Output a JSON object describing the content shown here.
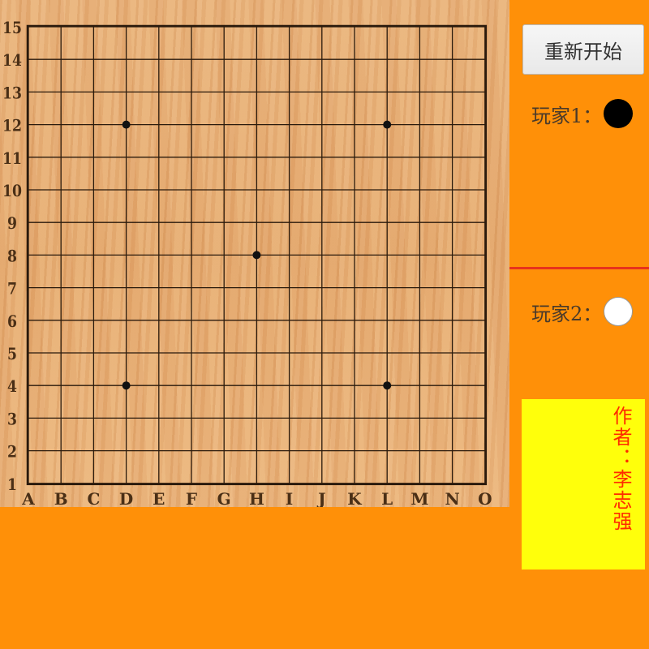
{
  "board": {
    "size": 15,
    "columns": [
      "A",
      "B",
      "C",
      "D",
      "E",
      "F",
      "G",
      "H",
      "I",
      "J",
      "K",
      "L",
      "M",
      "N",
      "O"
    ],
    "rows": [
      "15",
      "14",
      "13",
      "12",
      "11",
      "10",
      "9",
      "8",
      "7",
      "6",
      "5",
      "4",
      "3",
      "2",
      "1"
    ],
    "star_points": [
      [
        "D",
        "12"
      ],
      [
        "L",
        "12"
      ],
      [
        "H",
        "8"
      ],
      [
        "D",
        "4"
      ],
      [
        "L",
        "4"
      ]
    ],
    "stones": []
  },
  "controls": {
    "restart_label": "重新开始"
  },
  "players": [
    {
      "label": "玩家1：",
      "stone_color": "black",
      "icon": "black-stone-icon"
    },
    {
      "label": "玩家2：",
      "stone_color": "white",
      "icon": "white-stone-icon"
    }
  ],
  "credits": {
    "text": "作者：李志强"
  },
  "colors": {
    "background": "#ff9008",
    "divider": "#e8321c",
    "credits_bg": "#ffff0b",
    "credits_text": "#ff2a00",
    "grid": "#2a1a0c"
  }
}
